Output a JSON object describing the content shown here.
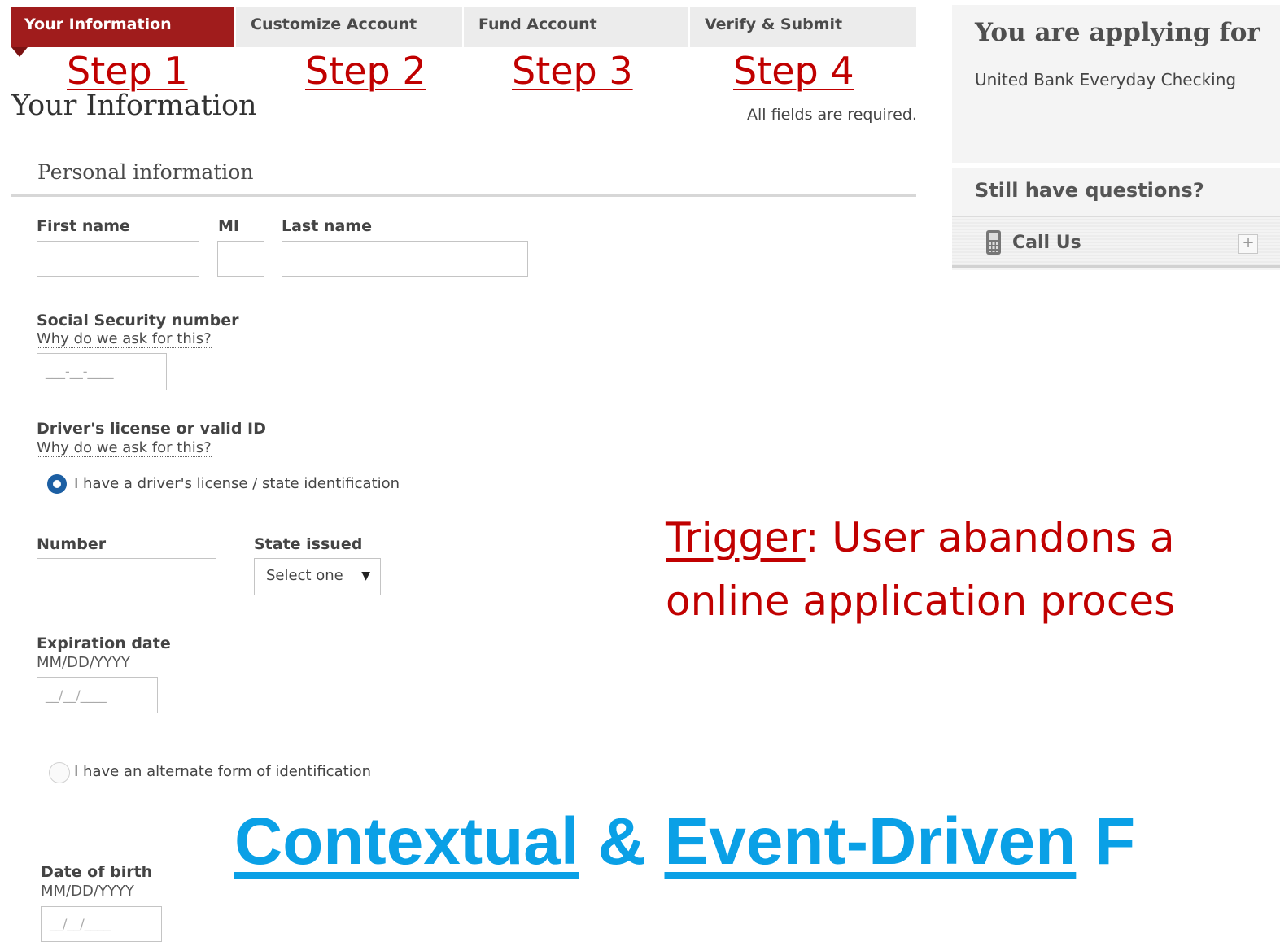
{
  "tabs": [
    {
      "label": "Your Information"
    },
    {
      "label": "Customize Account"
    },
    {
      "label": "Fund Account"
    },
    {
      "label": "Verify & Submit"
    }
  ],
  "steps": [
    "Step 1",
    "Step 2",
    "Step 3",
    "Step 4"
  ],
  "page": {
    "title": "Your Information",
    "required_note": "All fields are required."
  },
  "section": {
    "title": "Personal information"
  },
  "name_fields": {
    "first_label": "First name",
    "mi_label": "MI",
    "last_label": "Last name"
  },
  "ssn": {
    "label": "Social Security number",
    "help": "Why do we ask for this?",
    "placeholder": "___-__-____"
  },
  "license": {
    "label": "Driver's license or valid ID",
    "help": "Why do we ask for this?",
    "option_license": "I have a driver's license / state identification",
    "option_alternate": "I have an alternate form of identification",
    "number_label": "Number",
    "state_label": "State issued",
    "state_value": "Select one",
    "expiration_label": "Expiration date",
    "expiration_hint": "MM/DD/YYYY",
    "expiration_placeholder": "__/__/____"
  },
  "dob": {
    "label": "Date of birth",
    "hint": "MM/DD/YYYY",
    "placeholder": "__/__/____"
  },
  "panel": {
    "title": "You are applying for",
    "product": "United Bank Everyday Checking",
    "questions": "Still have questions?",
    "call": "Call Us",
    "plus": "+"
  },
  "annotation": {
    "trigger_word": "Trigger",
    "trigger_line1_rest": ": User abandons a",
    "trigger_line2": "online application proces"
  },
  "headline": {
    "word1": "Contextual",
    "amp": " & ",
    "word2": "Event-Driven",
    "tail": " F"
  },
  "colors": {
    "accent_red": "#a01c1c",
    "annotation_red": "#c00000",
    "headline_blue": "#0aa0e6",
    "radio_blue": "#1c5fa3"
  }
}
